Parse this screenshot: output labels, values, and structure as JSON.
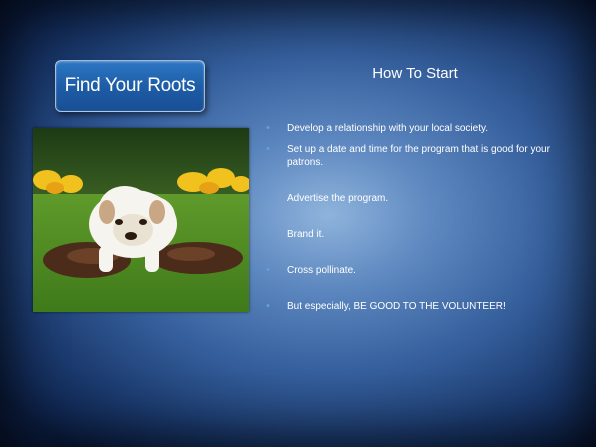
{
  "slide": {
    "title": "Find Your Roots",
    "heading": "How To Start",
    "image_alt": "Dog digging in a garden",
    "bullets": [
      "Develop a relationship with your local society.",
      "Set up a date and time for the program that is good for your patrons.",
      "Advertise the program.",
      "Brand it.",
      "Cross pollinate.",
      "But especially, BE GOOD TO THE VOLUNTEER!"
    ]
  },
  "colors": {
    "title_box": "#1e5da7",
    "bullet": "#5ea0e0",
    "background_center": "#8fb4dc",
    "background_edge": "#0c1f45"
  }
}
